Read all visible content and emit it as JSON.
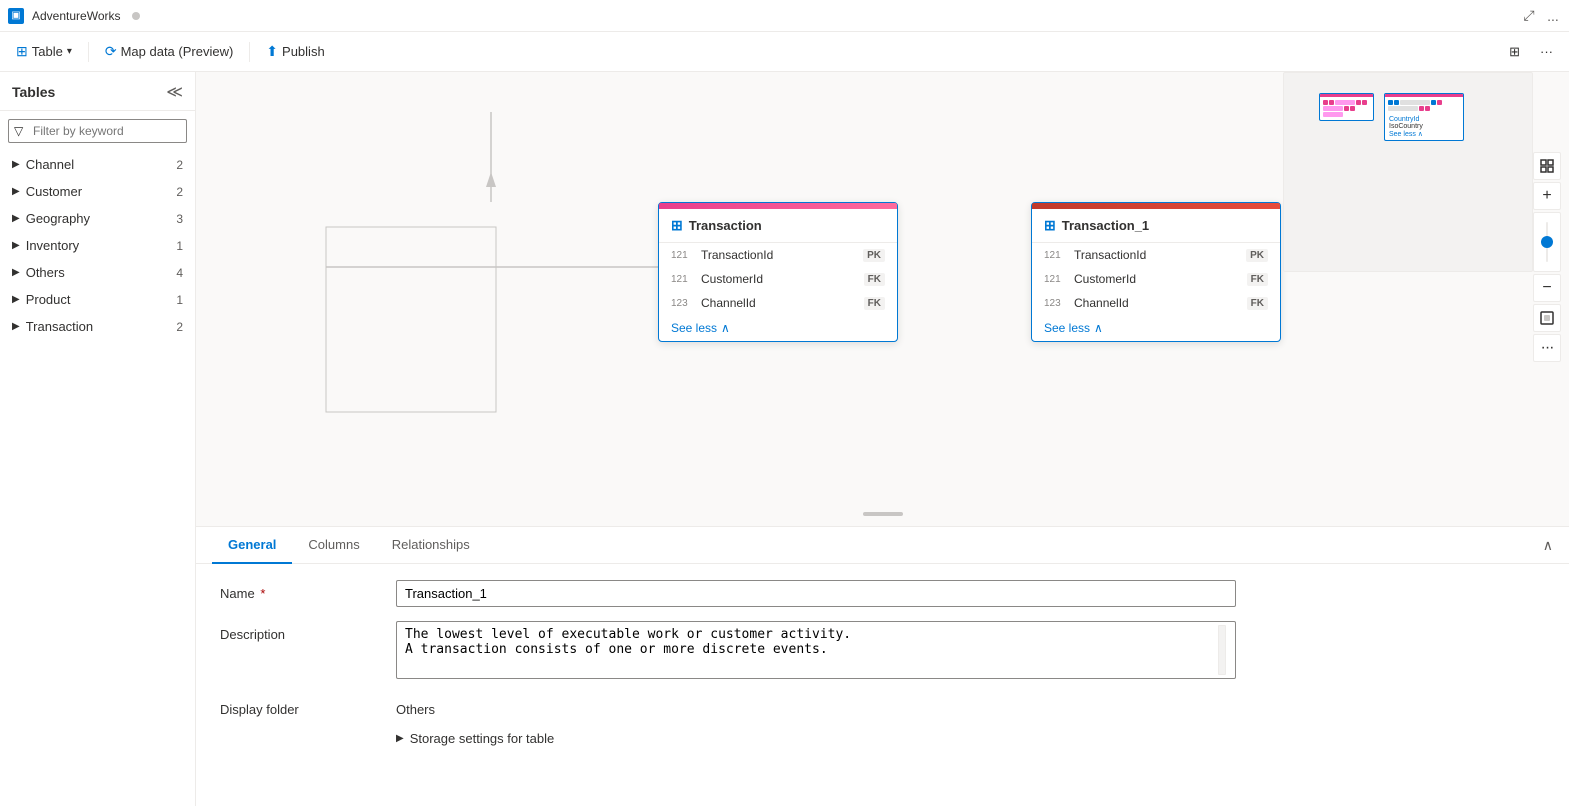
{
  "titleBar": {
    "icon": "▣",
    "title": "AdventureWorks",
    "dot": true,
    "maximizeIcon": "⤢",
    "moreIcon": "..."
  },
  "toolbar": {
    "tableLabel": "Table",
    "mapDataLabel": "Map data (Preview)",
    "publishLabel": "Publish",
    "rightIcons": [
      "⊞",
      "..."
    ]
  },
  "sidebar": {
    "title": "Tables",
    "collapseIcon": "≪",
    "filter": {
      "placeholder": "Filter by keyword",
      "icon": "▽"
    },
    "items": [
      {
        "name": "Channel",
        "count": 2
      },
      {
        "name": "Customer",
        "count": 2
      },
      {
        "name": "Geography",
        "count": 3
      },
      {
        "name": "Inventory",
        "count": 1
      },
      {
        "name": "Others",
        "count": 4
      },
      {
        "name": "Product",
        "count": 1
      },
      {
        "name": "Transaction",
        "count": 2
      }
    ]
  },
  "canvas": {
    "cards": [
      {
        "id": "transaction",
        "title": "Transaction",
        "fields": [
          {
            "type": "121",
            "name": "TransactionId",
            "badge": "PK"
          },
          {
            "type": "121",
            "name": "CustomerId",
            "badge": "FK"
          },
          {
            "type": "123",
            "name": "ChannelId",
            "badge": "FK"
          }
        ],
        "seeLess": "See less"
      },
      {
        "id": "transaction1",
        "title": "Transaction_1",
        "fields": [
          {
            "type": "121",
            "name": "TransactionId",
            "badge": "PK"
          },
          {
            "type": "121",
            "name": "CustomerId",
            "badge": "FK"
          },
          {
            "type": "123",
            "name": "ChannelId",
            "badge": "FK"
          }
        ],
        "seeLess": "See less"
      }
    ]
  },
  "zoomControls": {
    "fitIcon": "⊡",
    "plusIcon": "+",
    "minusIcon": "−",
    "minimapIcon": "⊞",
    "moreIcon": "..."
  },
  "minimap": {
    "countryText": "...ntry",
    "isoCountText": "abc IsoCount",
    "seeLess": "See less"
  },
  "bottomPanel": {
    "tabs": [
      {
        "label": "General",
        "active": true
      },
      {
        "label": "Columns",
        "active": false
      },
      {
        "label": "Relationships",
        "active": false
      }
    ],
    "collapseIcon": "∧",
    "form": {
      "nameLabel": "Name",
      "nameRequired": "*",
      "nameValue": "Transaction_1",
      "descriptionLabel": "Description",
      "descriptionLine1": "The lowest level of executable work or customer activity.",
      "descriptionLine2": "A transaction consists of one or more discrete events.",
      "displayFolderLabel": "Display folder",
      "displayFolderValue": "Others",
      "storageLabel": "Storage settings for table"
    }
  }
}
